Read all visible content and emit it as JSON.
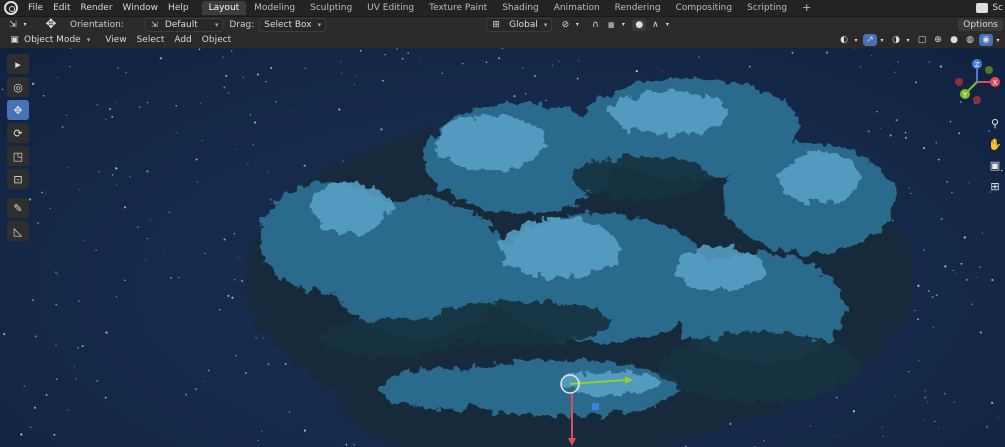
{
  "app": {
    "menus": [
      "File",
      "Edit",
      "Render",
      "Window",
      "Help"
    ],
    "workspaces": [
      "Layout",
      "Modeling",
      "Sculpting",
      "UV Editing",
      "Texture Paint",
      "Shading",
      "Animation",
      "Rendering",
      "Compositing",
      "Scripting"
    ],
    "active_workspace": "Layout",
    "add_workspace": "+",
    "scene_partial": "Sc"
  },
  "tool_header": {
    "orientation_label": "Orientation:",
    "orientation_value": "Default",
    "drag_label": "Drag:",
    "drag_value": "Select Box",
    "transform_orientation": "Global",
    "options_label": "Options"
  },
  "view_header": {
    "mode": "Object Mode",
    "menus": [
      "View",
      "Select",
      "Add",
      "Object"
    ]
  },
  "toolbar": {
    "tools": [
      "select-box",
      "cursor",
      "move",
      "rotate",
      "scale",
      "transform",
      "annotate",
      "measure"
    ],
    "active_tool": "move"
  },
  "gizmo": {
    "x_label": "X",
    "y_label": "Y",
    "z_label": "Z",
    "x_color": "#e04a5a",
    "y_color": "#7fbf2a",
    "z_color": "#3f7fe0"
  },
  "colors": {
    "accent": "#4772b3",
    "viewport_bg": "#15294a",
    "cloud_dark": "#132a3a",
    "cloud_mid": "#2e6f92",
    "cloud_light": "#5aa3c8"
  }
}
